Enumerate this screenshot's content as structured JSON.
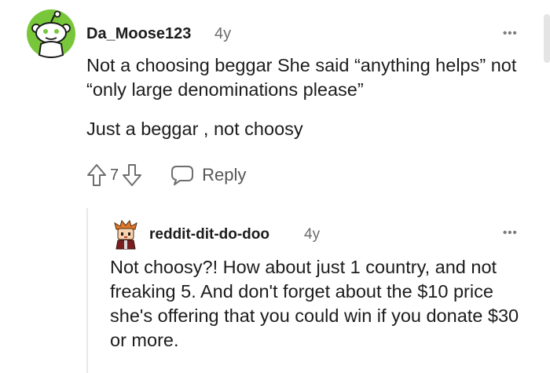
{
  "comment": {
    "username": "Da_Moose123",
    "age": "4y",
    "more_label": "•••",
    "paragraphs": [
      "Not a choosing beggar She said “anything helps” not “only large denominations please”",
      "Just a beggar , not choosy"
    ],
    "vote_count": "7",
    "reply_label": "Reply",
    "icons": {
      "avatar": "reddit-snoo-avatar",
      "upvote": "arrow-up-outline",
      "downvote": "arrow-down-outline",
      "reply": "speech-bubble"
    }
  },
  "reply": {
    "username": "reddit-dit-do-doo",
    "age": "4y",
    "more_label": "•••",
    "text": "Not choosy?! How about just 1 country, and not freaking 5. And don't forget about the $10 price she's offering that you could win if you donate $30 or more.",
    "icons": {
      "avatar": "pixel-character-avatar"
    }
  },
  "colors": {
    "avatar_bg": "#78c73a",
    "text": "#1c1c1c",
    "muted": "#6b6b6b",
    "icon": "#6e6e6e"
  }
}
